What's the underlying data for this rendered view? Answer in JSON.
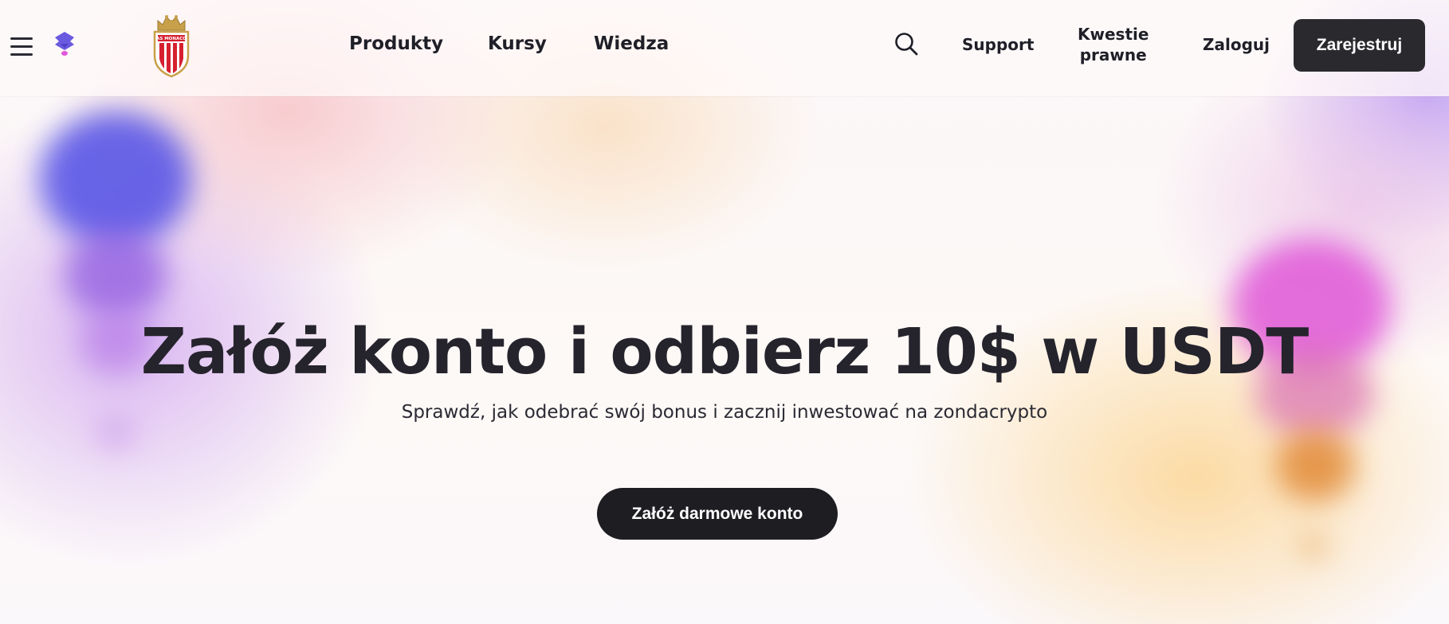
{
  "header": {
    "menu_icon": "hamburger-icon",
    "brand_icon": "zondacrypto-logo-icon",
    "club_logo_text": "AS MONACO",
    "nav": [
      {
        "label": "Produkty"
      },
      {
        "label": "Kursy"
      },
      {
        "label": "Wiedza"
      }
    ],
    "search_icon": "search-icon",
    "support_label": "Support",
    "legal_line1": "Kwestie",
    "legal_line2": "prawne",
    "login_label": "Zaloguj",
    "register_label": "Zarejestruj"
  },
  "hero": {
    "title": "Załóż konto i odbierz 10$ w USDT",
    "subtitle": "Sprawdź, jak odebrać swój bonus i zacznij inwestować na zondacrypto",
    "cta_label": "Załóż darmowe konto"
  },
  "colors": {
    "text_dark": "#25232c",
    "button_dark": "#1e1d22",
    "brand_purple": "#6a5ae0",
    "brand_pink": "#e058d8"
  }
}
